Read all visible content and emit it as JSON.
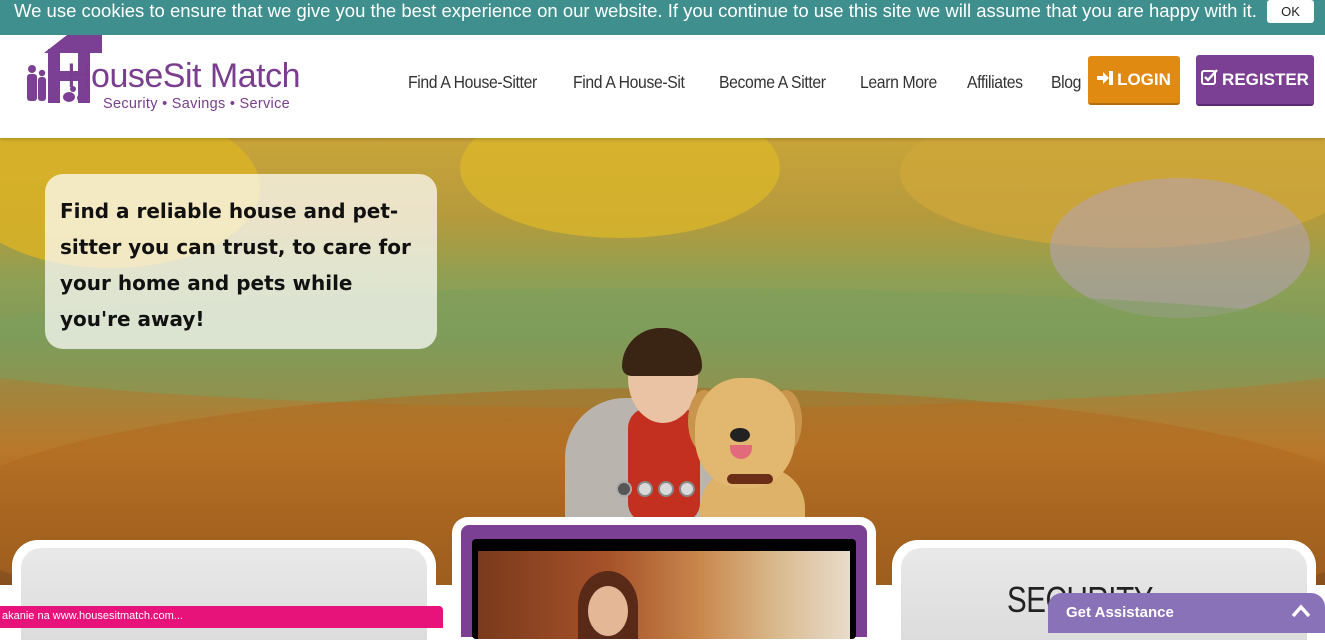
{
  "cookie_bar": {
    "message": "We use cookies to ensure that we give you the best experience on our website. If you continue to use this site we will assume that you are happy with it.",
    "ok_label": "OK"
  },
  "header": {
    "logo_word": "HouseSit Match",
    "logo_tagline": "Security  •  Savings  •  Service",
    "nav": [
      {
        "label": "Find A House-Sitter"
      },
      {
        "label": "Find A House-Sit"
      },
      {
        "label": "Become A Sitter"
      },
      {
        "label": "Learn More"
      },
      {
        "label": "Affiliates"
      },
      {
        "label": "Blog"
      }
    ],
    "login_label": "LOGIN",
    "register_label": "REGISTER",
    "login_icon": "sign-in-icon",
    "register_icon": "check-square-icon"
  },
  "hero": {
    "caption": "Find a reliable house and pet-sitter you can trust, to care for your home and pets while you're away!",
    "slides": 4,
    "active_slide": 1
  },
  "cards": {
    "right_title": "SECURITY"
  },
  "status_bar": {
    "text": "akanie na www.housesitmatch.com..."
  },
  "assist": {
    "label": "Get Assistance",
    "chevron": "^"
  },
  "colors": {
    "brand_purple": "#7b3f93",
    "login_orange": "#e08a12",
    "cookie_teal": "#3f8f8f",
    "status_pink": "#e8127b",
    "assist_purple": "#8a72b8"
  }
}
